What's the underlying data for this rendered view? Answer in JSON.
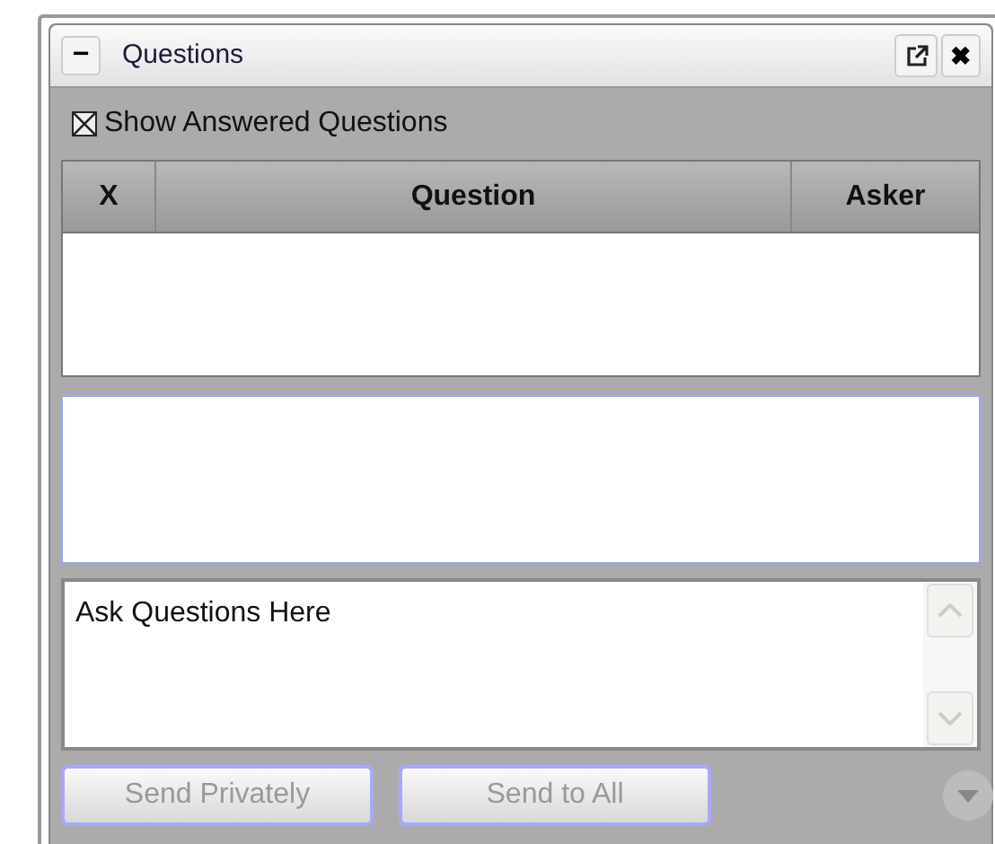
{
  "panel": {
    "title": "Questions",
    "collapse_label": "−",
    "close_label": "✖"
  },
  "show_answered": {
    "label": "Show Answered Questions",
    "checked": true
  },
  "table": {
    "columns": [
      "X",
      "Question",
      "Asker"
    ]
  },
  "ask_field": {
    "value": "Ask Questions Here"
  },
  "buttons": [
    {
      "label": "Send Privately",
      "disabled": true
    },
    {
      "label": "Send to All",
      "disabled": true
    }
  ]
}
